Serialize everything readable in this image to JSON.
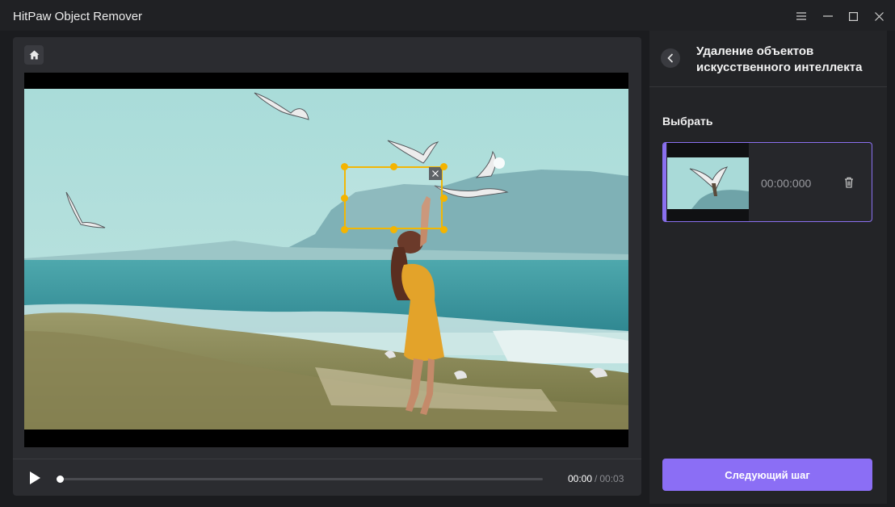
{
  "window": {
    "title": "HitPaw Object Remover",
    "controls": [
      "menu-icon",
      "minimize-icon",
      "maximize-icon",
      "close-icon"
    ]
  },
  "player": {
    "current_time": "00:00",
    "separator": "/",
    "total_time": "00:03",
    "progress": 0
  },
  "panel": {
    "title": "Удаление объектов искусственного интеллекта",
    "section_label": "Выбрать",
    "selection": {
      "time": "00:00:000"
    },
    "next_button": "Следующий шаг"
  },
  "colors": {
    "accent": "#8b6ef5",
    "selection_border": "#f2b705",
    "window_bg": "#1b1c1f",
    "panel_bg": "#232427"
  }
}
